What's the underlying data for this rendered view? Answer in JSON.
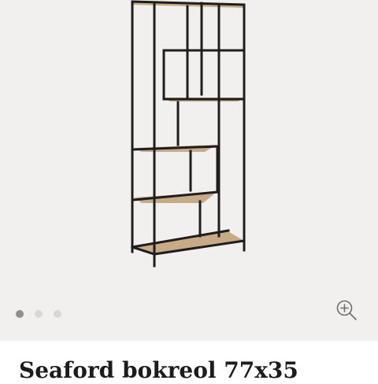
{
  "product": {
    "title": "Seaford bokreol 77x35",
    "image_alt": "Seaford bokreol"
  },
  "gallery": {
    "slide_count": 3,
    "active_index": 0,
    "dot_active_color": "#8f8f8f",
    "dot_inactive_color": "#d9d8d6",
    "background_color": "#f1f0ef",
    "zoom_icon": "zoom-in-icon"
  },
  "colors": {
    "frame": "#1e1e1e",
    "wood": "#c9aa86",
    "wood_dark": "#a88765"
  }
}
